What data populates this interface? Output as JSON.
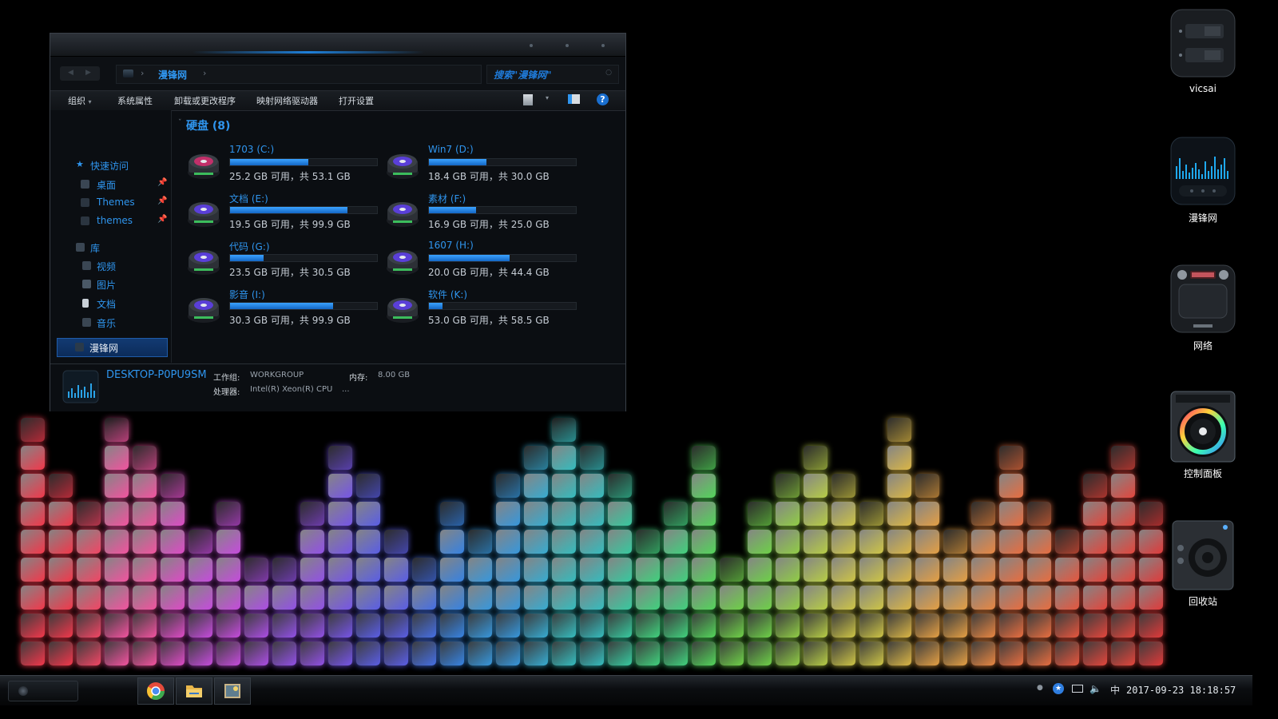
{
  "window": {
    "address_path": "漫锋网",
    "search_placeholder": "搜索\"漫锋网\"",
    "toolbar": {
      "organize": "组织",
      "system_properties": "系统属性",
      "uninstall": "卸载或更改程序",
      "map_drive": "映射网络驱动器",
      "open_settings": "打开设置",
      "help": "?"
    },
    "nav": {
      "quick_access": "快速访问",
      "desktop": "桌面",
      "themes_upper": "Themes",
      "themes_lower": "themes",
      "library": "库",
      "videos": "视频",
      "pictures": "图片",
      "documents": "文档",
      "music": "音乐",
      "this_pc": "漫锋网",
      "network": "网络"
    },
    "group_title": "硬盘 (8)",
    "drives": [
      {
        "name": "1703 (C:)",
        "size": "25.2 GB 可用，共 53.1 GB",
        "used": 0.53
      },
      {
        "name": "Win7 (D:)",
        "size": "18.4 GB 可用，共 30.0 GB",
        "used": 0.39
      },
      {
        "name": "文档 (E:)",
        "size": "19.5 GB 可用，共 99.9 GB",
        "used": 0.8
      },
      {
        "name": "素材 (F:)",
        "size": "16.9 GB 可用，共 25.0 GB",
        "used": 0.32
      },
      {
        "name": "代码 (G:)",
        "size": "23.5 GB 可用，共 30.5 GB",
        "used": 0.23
      },
      {
        "name": "1607 (H:)",
        "size": "20.0 GB 可用，共 44.4 GB",
        "used": 0.55
      },
      {
        "name": "影音 (I:)",
        "size": "30.3 GB 可用，共 99.9 GB",
        "used": 0.7
      },
      {
        "name": "软件 (K:)",
        "size": "53.0 GB 可用，共 58.5 GB",
        "used": 0.09
      }
    ],
    "details": {
      "computer_name": "DESKTOP-P0PU9SM",
      "workgroup_label": "工作组:",
      "workgroup_value": "WORKGROUP",
      "memory_label": "内存:",
      "memory_value": "8.00 GB",
      "processor_label": "处理器:",
      "processor_value": "Intel(R) Xeon(R) CPU",
      "ellipsis": "..."
    }
  },
  "desktop_icons": [
    "vicsai",
    "漫锋网",
    "网络",
    "控制面板",
    "回收站"
  ],
  "taskbar": {
    "tray_ime": "中",
    "clock": "2017-09-23 18:18:57"
  },
  "colors": {
    "accent": "#2f95ee",
    "window_bg": "#0b0e12",
    "bar_fill": "#1e7fd8"
  }
}
